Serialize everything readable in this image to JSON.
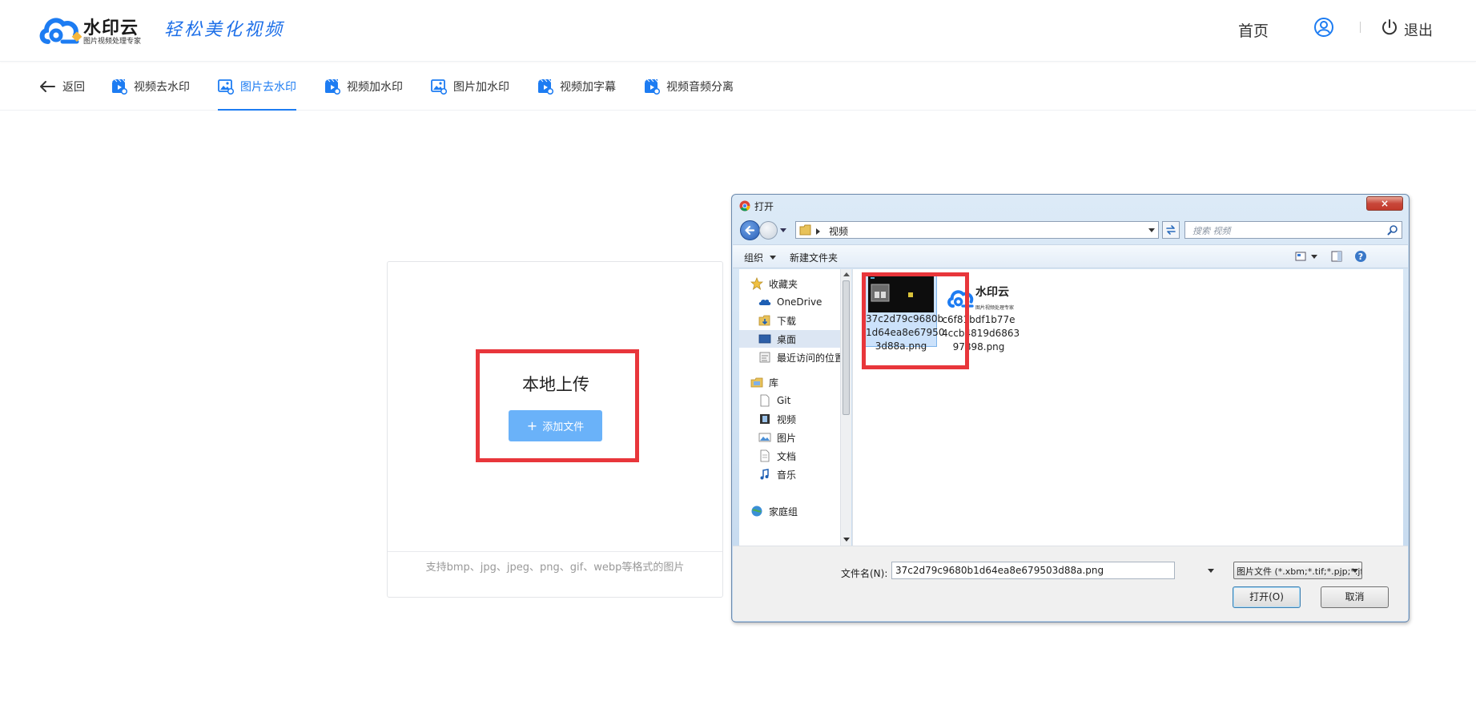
{
  "header": {
    "brand_name": "水印云",
    "brand_tagline": "图片视频处理专家",
    "slogan": "轻松美化视频",
    "home_label": "首页",
    "logout_label": "退出"
  },
  "tabs": [
    {
      "label": "返回",
      "icon": "arrow-left-icon"
    },
    {
      "label": "视频去水印",
      "icon": "video-clip-icon"
    },
    {
      "label": "图片去水印",
      "icon": "image-icon",
      "active": true
    },
    {
      "label": "视频加水印",
      "icon": "video-clip-icon"
    },
    {
      "label": "图片加水印",
      "icon": "image-icon"
    },
    {
      "label": "视频加字幕",
      "icon": "video-clip-icon"
    },
    {
      "label": "视频音频分离",
      "icon": "video-clip-icon"
    }
  ],
  "upload": {
    "title": "本地上传",
    "button_label": "添加文件",
    "hint": "支持bmp、jpg、jpeg、png、gif、webp等格式的图片"
  },
  "dialog": {
    "title": "打开",
    "address_path": "视频",
    "search_placeholder": "搜索 视频",
    "organize_label": "组织",
    "new_folder_label": "新建文件夹",
    "nav_items": [
      {
        "label": "收藏夹",
        "icon": "star-icon"
      },
      {
        "label": "OneDrive",
        "icon": "cloud-icon"
      },
      {
        "label": "下载",
        "icon": "download-folder-icon"
      },
      {
        "label": "桌面",
        "icon": "desktop-icon",
        "selected": true
      },
      {
        "label": "最近访问的位置",
        "icon": "recent-places-icon"
      },
      {
        "label": "库",
        "icon": "library-icon"
      },
      {
        "label": "Git",
        "icon": "document-icon"
      },
      {
        "label": "视频",
        "icon": "film-icon"
      },
      {
        "label": "图片",
        "icon": "picture-icon"
      },
      {
        "label": "文档",
        "icon": "document-icon"
      },
      {
        "label": "音乐",
        "icon": "music-icon"
      },
      {
        "label": "家庭组",
        "icon": "homegroup-icon"
      }
    ],
    "files": [
      {
        "name_lines": [
          "37c2d79c9680b",
          "1d64ea8e67950",
          "3d88a.png"
        ],
        "selected": true
      },
      {
        "name_lines": [
          "c6f81bdf1b77e",
          "4ccb4819d6863",
          "97898.png"
        ],
        "thumb_brand": "水印云",
        "thumb_tagline": "图片视频处理专家"
      }
    ],
    "filename_label": "文件名(N):",
    "filename_value": "37c2d79c9680b1d64ea8e679503d88a.png",
    "filter_value": "图片文件 (*.xbm;*.tif;*.pjp;*.jfif",
    "open_label": "打开(O)",
    "cancel_label": "取消",
    "close_glyph": "×"
  },
  "colors": {
    "accent": "#1d7cf2",
    "button": "#6ab2f9",
    "highlight": "#e8363b"
  }
}
